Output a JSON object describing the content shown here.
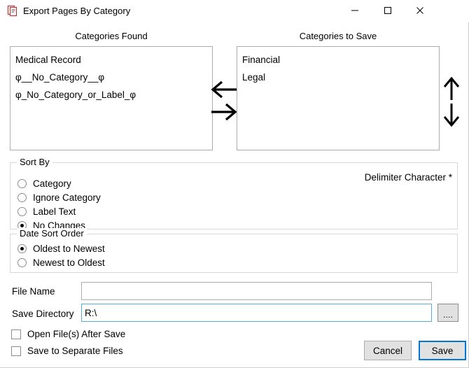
{
  "window": {
    "title": "Export Pages By Category",
    "icon": "document-pages-icon",
    "minimize_label": "Minimize",
    "maximize_label": "Maximize",
    "close_label": "Close"
  },
  "lists": {
    "found": {
      "header": "Categories Found",
      "items": [
        "Medical Record",
        "φ__No_Category__φ",
        "φ_No_Category_or_Label_φ"
      ]
    },
    "to_save": {
      "header": "Categories to Save",
      "items": [
        "Financial",
        "Legal"
      ]
    }
  },
  "transfer": {
    "move_left": "move-left-arrow",
    "move_right": "move-right-arrow"
  },
  "reorder": {
    "move_up": "move-up-arrow",
    "move_down": "move-down-arrow"
  },
  "sort_by": {
    "legend": "Sort By",
    "options": [
      {
        "label": "Category",
        "selected": false
      },
      {
        "label": "Ignore Category",
        "selected": false
      },
      {
        "label": "Label Text",
        "selected": false
      },
      {
        "label": "No Changes",
        "selected": true
      }
    ]
  },
  "delimiter": {
    "label": "Delimiter Character *"
  },
  "date_sort_order": {
    "legend": "Date Sort Order",
    "options": [
      {
        "label": "Oldest to Newest",
        "selected": true
      },
      {
        "label": "Newest to Oldest",
        "selected": false
      }
    ]
  },
  "fields": {
    "file_name": {
      "label": "File Name",
      "value": "",
      "placeholder": ""
    },
    "save_directory": {
      "label": "Save Directory",
      "value": "R:\\",
      "placeholder": ""
    },
    "browse_label": "...."
  },
  "checkboxes": [
    {
      "label": "Open File(s) After Save",
      "checked": false
    },
    {
      "label": "Save to Separate Files",
      "checked": false
    }
  ],
  "actions": {
    "cancel_label": "Cancel",
    "save_label": "Save"
  },
  "colors": {
    "focus_border": "#5ba7e0",
    "default_button_border": "#0078d7",
    "control_face": "#e1e1e1",
    "control_border": "#acacac",
    "group_border": "#d8d8d8",
    "icon_red": "#b03a3a"
  }
}
